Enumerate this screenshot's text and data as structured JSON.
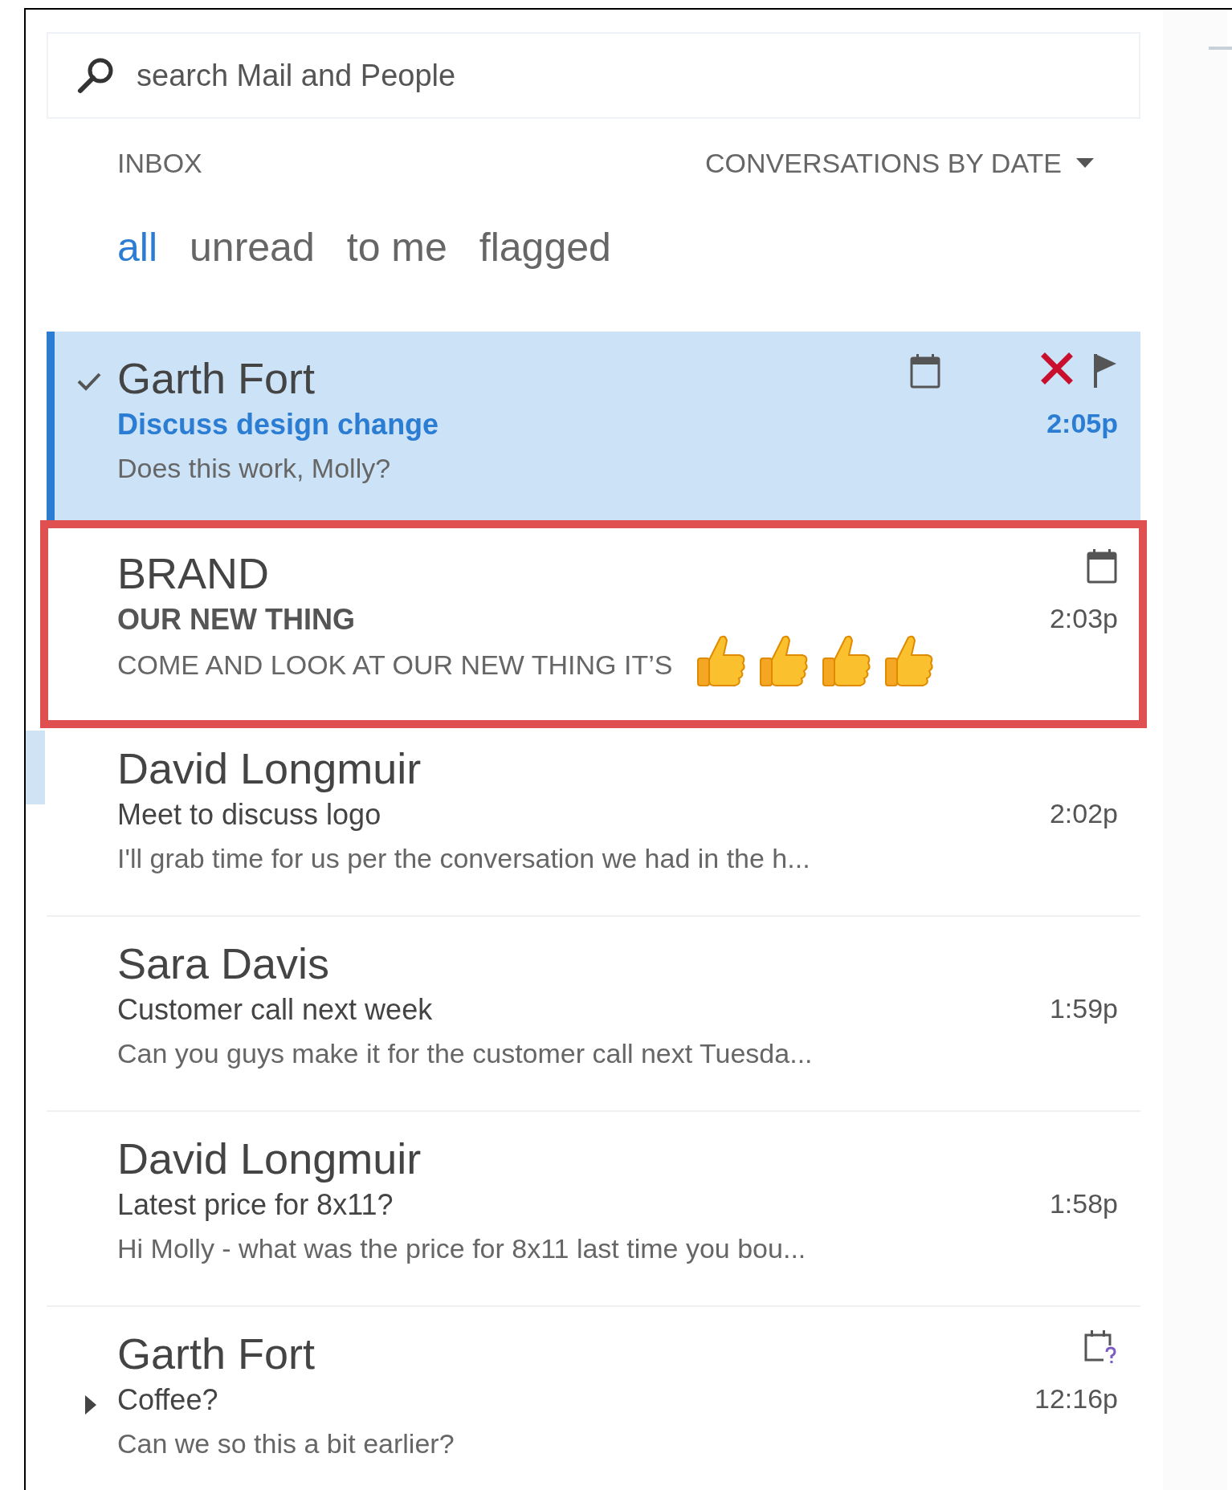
{
  "search": {
    "placeholder": "search Mail and People"
  },
  "header": {
    "folder": "INBOX",
    "sort": "CONVERSATIONS BY DATE"
  },
  "filters": [
    {
      "label": "all",
      "selected": true
    },
    {
      "label": "unread",
      "selected": false
    },
    {
      "label": "to me",
      "selected": false
    },
    {
      "label": "flagged",
      "selected": false
    }
  ],
  "messages": [
    {
      "sender": "Garth Fort",
      "subject": "Discuss design change",
      "preview": "Does this work, Molly?",
      "time": "2:05p",
      "selected": true,
      "checked": true,
      "unread": true,
      "highlighted": false,
      "expandable": false,
      "icons": [
        {
          "kind": "calendar"
        },
        {
          "kind": "delete"
        },
        {
          "kind": "flag"
        }
      ]
    },
    {
      "sender": "BRAND",
      "subject": "OUR NEW THING",
      "preview": "COME AND LOOK AT OUR NEW THING IT’S",
      "time": "2:03p",
      "selected": false,
      "checked": false,
      "unread": true,
      "highlighted": true,
      "expandable": false,
      "icons": [
        {
          "kind": "calendar"
        }
      ],
      "emojis": [
        {
          "kind": "thumbs_up"
        },
        {
          "kind": "thumbs_up"
        },
        {
          "kind": "thumbs_up"
        },
        {
          "kind": "thumbs_up"
        }
      ]
    },
    {
      "sender": "David Longmuir",
      "subject": "Meet to discuss logo",
      "preview": "I'll grab time for us per the conversation we had in the h...",
      "time": "2:02p",
      "selected": false,
      "checked": false,
      "unread": false,
      "highlighted": false,
      "expandable": false
    },
    {
      "sender": "Sara Davis",
      "subject": "Customer call next week",
      "preview": "Can you guys make it for the customer call next Tuesda...",
      "time": "1:59p",
      "selected": false,
      "checked": false,
      "unread": false,
      "highlighted": false,
      "expandable": false
    },
    {
      "sender": "David Longmuir",
      "subject": "Latest price for 8x11?",
      "preview": "Hi Molly - what was the price for 8x11 last time you bou...",
      "time": "1:58p",
      "selected": false,
      "checked": false,
      "unread": false,
      "highlighted": false,
      "expandable": false
    },
    {
      "sender": "Garth Fort",
      "subject": "Coffee?",
      "preview": "Can we so this a bit earlier?",
      "time": "12:16p",
      "selected": false,
      "checked": false,
      "unread": false,
      "highlighted": false,
      "expandable": true,
      "icons": [
        {
          "kind": "calendar_question"
        }
      ]
    }
  ]
}
